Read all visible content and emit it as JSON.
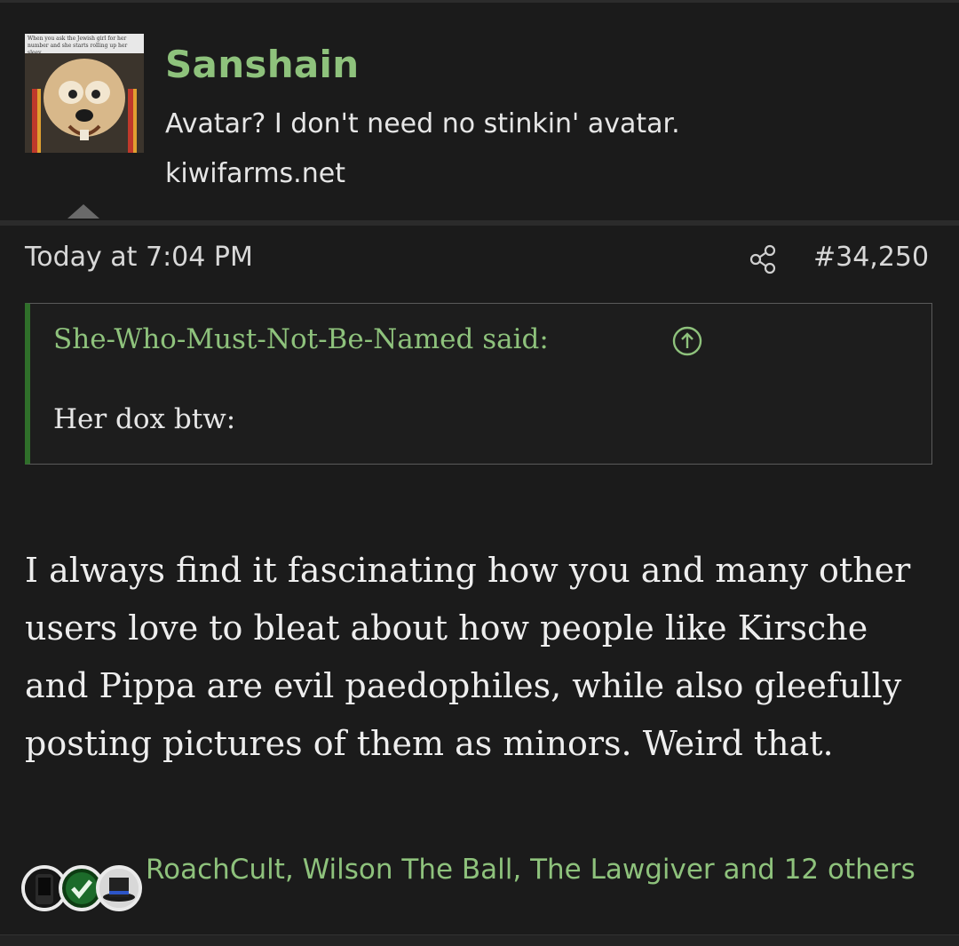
{
  "post": {
    "author": {
      "username": "Sanshain",
      "title": "Avatar? I don't need no stinkin' avatar.",
      "site": "kiwifarms.net",
      "avatar_caption": "When you ask the Jewish girl for her number and she starts rolling up her sleev"
    },
    "timestamp": "Today at 7:04 PM",
    "share_icon": "share-icon",
    "post_number": "#34,250",
    "quote": {
      "author_label": "She-Who-Must-Not-Be-Named said:",
      "jump_icon": "arrow-up-circle-icon",
      "text": "Her dox btw:"
    },
    "body": "I always find it fascinating how you and many other users love to bleat about how people like Kirsche and Pippa are evil paedophiles, while also gleefully posting pictures of them as minors. Weird that.",
    "reactions": {
      "users_text": "RoachCult, Wilson The Ball, The Lawgiver and 12 others"
    }
  },
  "colors": {
    "background": "#1b1b1b",
    "accent_green": "#8ec27c",
    "quote_bar": "#2f6f2a",
    "text": "#e6e6e6"
  }
}
